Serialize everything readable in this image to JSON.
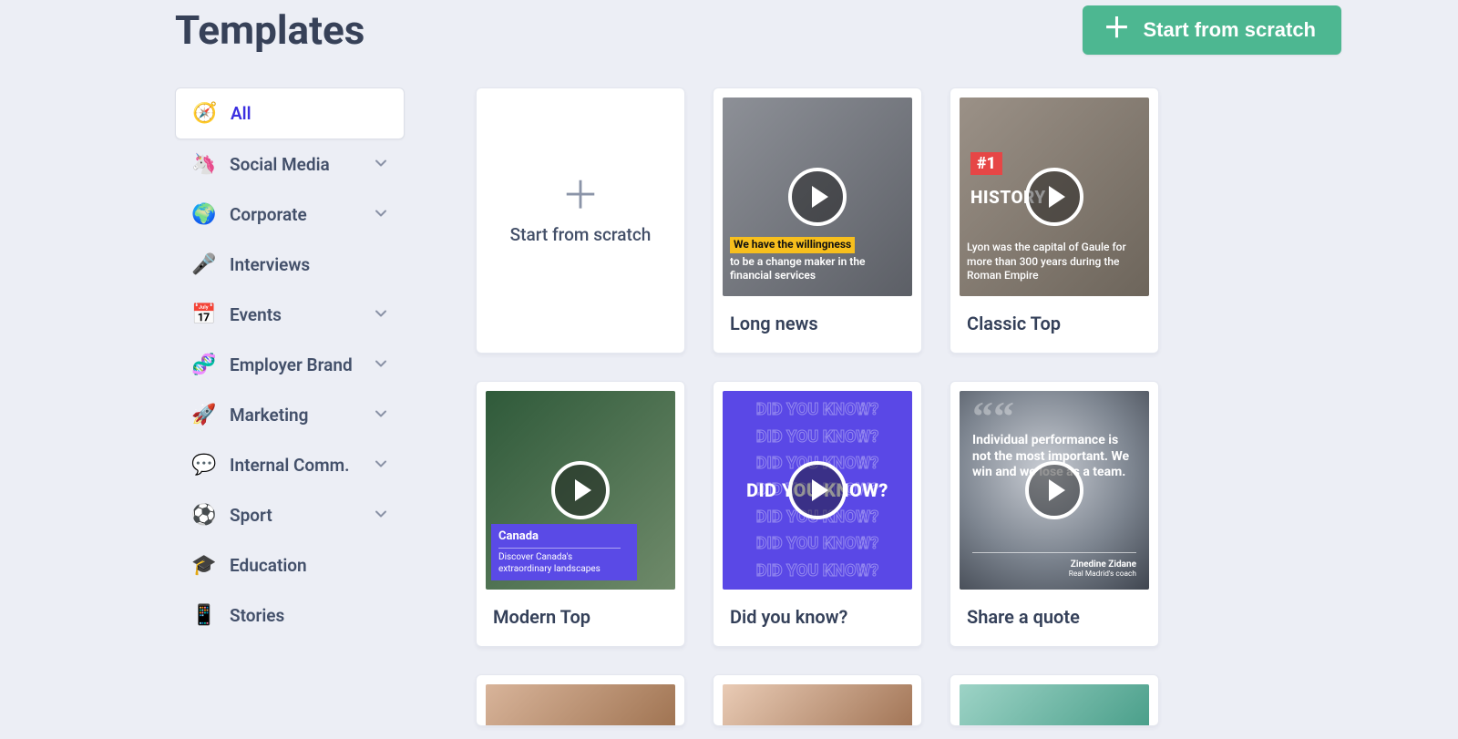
{
  "header": {
    "title": "Templates",
    "scratch_button": "Start from scratch"
  },
  "sidebar": {
    "items": [
      {
        "icon": "🧭",
        "label": "All",
        "active": true,
        "expandable": false
      },
      {
        "icon": "🦄",
        "label": "Social Media",
        "active": false,
        "expandable": true
      },
      {
        "icon": "🌍",
        "label": "Corporate",
        "active": false,
        "expandable": true
      },
      {
        "icon": "🎤",
        "label": "Interviews",
        "active": false,
        "expandable": false
      },
      {
        "icon": "📅",
        "label": "Events",
        "active": false,
        "expandable": true
      },
      {
        "icon": "🧬",
        "label": "Employer Brand",
        "active": false,
        "expandable": true
      },
      {
        "icon": "🚀",
        "label": "Marketing",
        "active": false,
        "expandable": true
      },
      {
        "icon": "💬",
        "label": "Internal Comm.",
        "active": false,
        "expandable": true
      },
      {
        "icon": "⚽",
        "label": "Sport",
        "active": false,
        "expandable": true
      },
      {
        "icon": "🎓",
        "label": "Education",
        "active": false,
        "expandable": false
      },
      {
        "icon": "📱",
        "label": "Stories",
        "active": false,
        "expandable": false
      }
    ]
  },
  "scratch_card": {
    "label": "Start from scratch"
  },
  "templates": [
    {
      "title": "Long news",
      "thumb_style": "grey",
      "overlay": {
        "type": "long-news",
        "highlight": "We have the willingness",
        "line": "to be a change maker in the financial services"
      }
    },
    {
      "title": "Classic Top",
      "thumb_style": "stone",
      "overlay": {
        "type": "classic-top",
        "badge": "#1",
        "heading": "HISTORY",
        "desc": "Lyon was the capital of Gaule for more than 300 years during the Roman Empire"
      }
    },
    {
      "title": "Modern Top",
      "thumb_style": "forest",
      "overlay": {
        "type": "modern-top",
        "country": "Canada",
        "desc": "Discover Canada's extraordinary landscapes"
      }
    },
    {
      "title": "Did you know?",
      "thumb_style": "purple",
      "overlay": {
        "type": "dyk",
        "text": "DID YOU KNOW?"
      }
    },
    {
      "title": "Share a quote",
      "thumb_style": "blur",
      "overlay": {
        "type": "quote",
        "text": "Individual performance is not the most important. We win and we lose as a team.",
        "author": "Zinedine Zidane",
        "role": "Real Madrid's coach"
      }
    }
  ],
  "partial_row_styles": [
    "peach",
    "skin",
    "mint"
  ]
}
